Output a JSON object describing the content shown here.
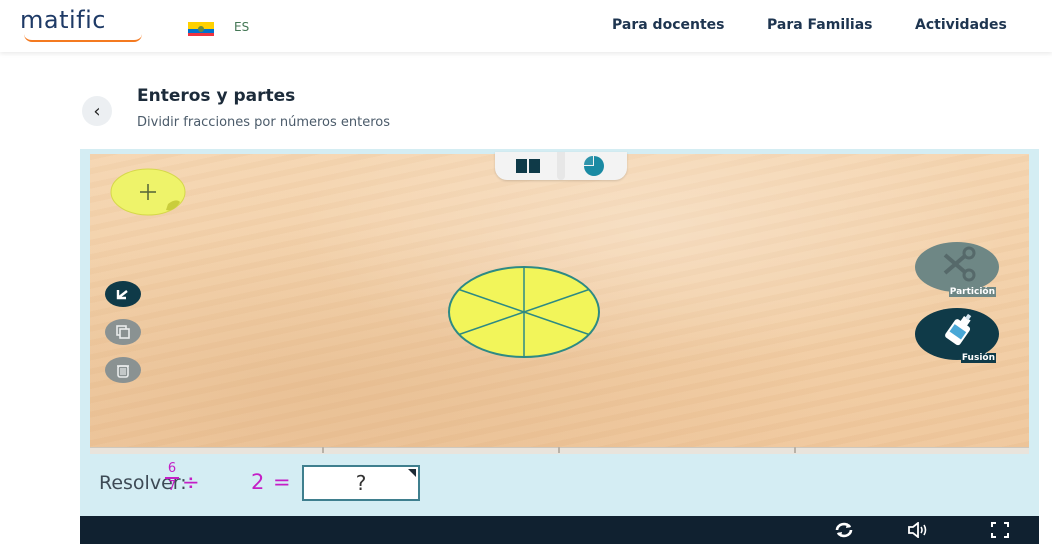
{
  "header": {
    "logo": "matific",
    "language": "ES",
    "nav": [
      "Para docentes",
      "Para Familias",
      "Actividades"
    ]
  },
  "activity": {
    "title": "Enteros y partes",
    "subtitle": "Dividir fracciones por números enteros"
  },
  "tools": {
    "right": [
      {
        "label": "Partición",
        "icon": "scissors-icon"
      },
      {
        "label": "Fusión",
        "icon": "glue-icon"
      }
    ],
    "left": [
      "undo-icon",
      "duplicate-icon",
      "trash-icon"
    ],
    "tabs": [
      "bar-view-icon",
      "pie-view-icon"
    ]
  },
  "problem": {
    "label": "Resolver:",
    "numerator": "6",
    "denominator": "7",
    "operator": "÷",
    "divisor": "2",
    "equals": "=",
    "answer_placeholder": "?"
  },
  "colors": {
    "pie_fill": "#f2f55a",
    "pie_stroke": "#2d8a84",
    "fraction_magenta": "#c41ec6",
    "dark_teal": "#0f3a48",
    "footer": "#102130"
  }
}
